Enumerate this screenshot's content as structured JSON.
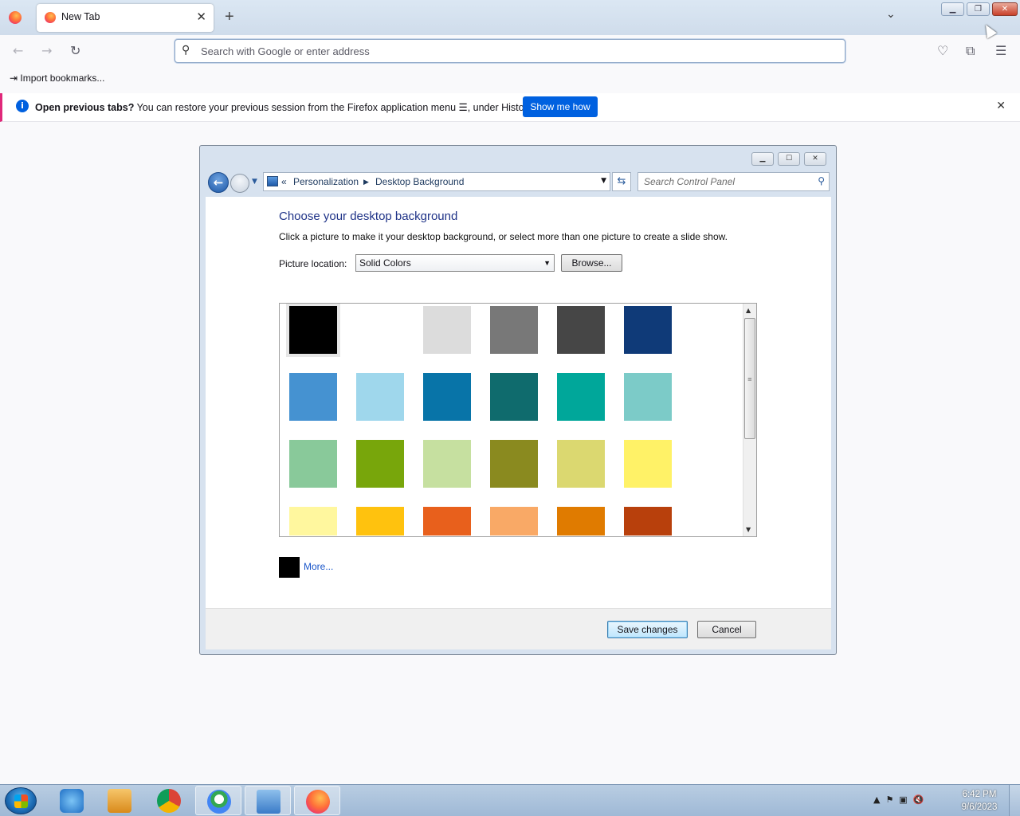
{
  "browser": {
    "tab_title": "New Tab",
    "url_placeholder": "Search with Google or enter address",
    "bookmark_import": "Import bookmarks...",
    "notification": {
      "bold": "Open previous tabs?",
      "text": " You can restore your previous session from the Firefox application menu ☰, under History.",
      "button": "Show me how"
    }
  },
  "window": {
    "breadcrumb": [
      "Personalization",
      "Desktop Background"
    ],
    "search_placeholder": "Search Control Panel",
    "heading": "Choose your desktop background",
    "description": "Click a picture to make it your desktop background, or select more than one picture to create a slide show.",
    "location_label": "Picture location:",
    "location_value": "Solid Colors",
    "browse_button": "Browse...",
    "more_link": "More...",
    "save_button": "Save changes",
    "cancel_button": "Cancel",
    "selected_color": "#000000",
    "swatches": [
      [
        "#000000",
        "#ffffff",
        "#dcdcdc",
        "#787878",
        "#464646",
        "#0f3a78"
      ],
      [
        "#4592d1",
        "#9fd7ec",
        "#0874a8",
        "#0f6b6d",
        "#00a79a",
        "#7ccbc8"
      ],
      [
        "#89c99a",
        "#78a60b",
        "#c6e0a0",
        "#8a8a1f",
        "#dbd870",
        "#fff267"
      ],
      [
        "#fff79e",
        "#ffc20e",
        "#e8601c",
        "#f9a966",
        "#e07b00",
        "#b8400c"
      ]
    ]
  },
  "taskbar": {
    "time": "6:42 PM",
    "date": "9/6/2023",
    "apps": [
      "internet-explorer",
      "media-player",
      "chrome",
      "maps",
      "control-panel",
      "firefox"
    ]
  }
}
